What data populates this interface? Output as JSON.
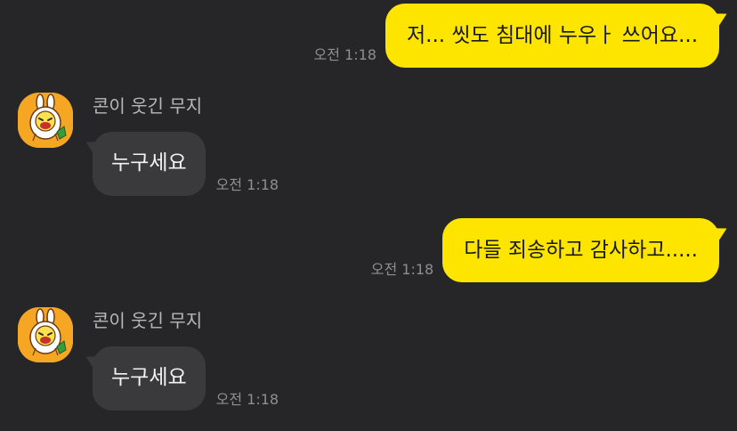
{
  "colors": {
    "background": "#262629",
    "sent_bubble": "#fee500",
    "received_bubble": "#3a3a3d",
    "timestamp": "#8e8e93",
    "avatar_bg": "#f5a623"
  },
  "messages": [
    {
      "type": "sent",
      "text": "저... 씻도 침대에 누우ㅏ 쓰어요...",
      "time": "오전 1:18"
    },
    {
      "type": "received",
      "sender": "콘이 웃긴 무지",
      "avatar_icon": "muzi-con-character-icon",
      "text": "누구세요",
      "time": "오전 1:18"
    },
    {
      "type": "sent",
      "text": "다들 죄송하고 감사하고.....",
      "time": "오전 1:18"
    },
    {
      "type": "received",
      "sender": "콘이 웃긴 무지",
      "avatar_icon": "muzi-con-character-icon",
      "text": "누구세요",
      "time": "오전 1:18"
    }
  ]
}
